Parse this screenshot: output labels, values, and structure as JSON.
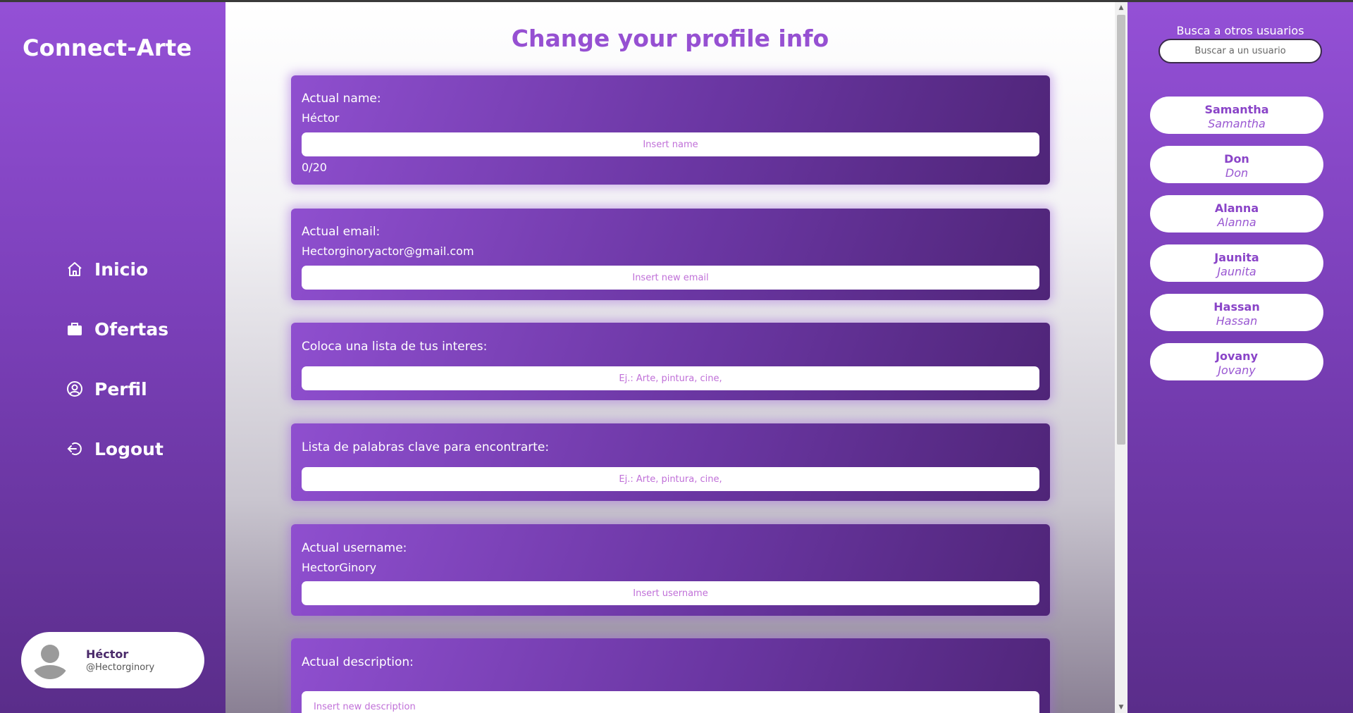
{
  "app": {
    "brand": "Connect-Arte"
  },
  "nav": [
    {
      "label": "Inicio",
      "icon": "home-icon"
    },
    {
      "label": "Ofertas",
      "icon": "briefcase-icon"
    },
    {
      "label": "Perfil",
      "icon": "user-circle-icon"
    },
    {
      "label": "Logout",
      "icon": "logout-icon"
    }
  ],
  "current_user": {
    "name": "Héctor",
    "handle": "@Hectorginory"
  },
  "main": {
    "title": "Change your profile info",
    "name_card": {
      "label": "Actual name:",
      "value": "Héctor",
      "placeholder": "Insert name",
      "counter": "0/20"
    },
    "email_card": {
      "label": "Actual email:",
      "value": "Hectorginoryactor@gmail.com",
      "placeholder": "Insert new email"
    },
    "interests_card": {
      "label": "Coloca una lista de tus interes:",
      "placeholder": "Ej.: Arte, pintura, cine,"
    },
    "keywords_card": {
      "label": "Lista de palabras clave para encontrarte:",
      "placeholder": "Ej.: Arte, pintura, cine,"
    },
    "username_card": {
      "label": "Actual username:",
      "value": "HectorGinory",
      "placeholder": "Insert username"
    },
    "description_card": {
      "label": "Actual description:",
      "placeholder": "Insert new description"
    }
  },
  "search": {
    "label": "Busca a otros usuarios",
    "placeholder": "Buscar a un usuario"
  },
  "users": [
    {
      "name": "Samantha",
      "handle": "Samantha"
    },
    {
      "name": "Don",
      "handle": "Don"
    },
    {
      "name": "Alanna",
      "handle": "Alanna"
    },
    {
      "name": "Jaunita",
      "handle": "Jaunita"
    },
    {
      "name": "Hassan",
      "handle": "Hassan"
    },
    {
      "name": "Jovany",
      "handle": "Jovany"
    }
  ],
  "colors": {
    "accent": "#9650d2",
    "sidebar_top": "#9450d6",
    "sidebar_bottom": "#5a2d8a",
    "placeholder": "#c070d8"
  }
}
